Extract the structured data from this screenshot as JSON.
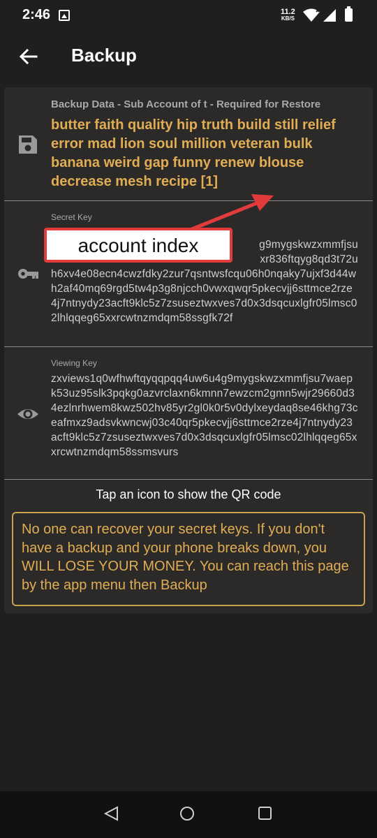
{
  "status_bar": {
    "time": "2:46",
    "net_speed_value": "11.2",
    "net_speed_unit": "KB/S"
  },
  "app_bar": {
    "title": "Backup",
    "back_icon": "arrow-back-icon"
  },
  "backup_data": {
    "label": "Backup Data - Sub Account of t - Required for Restore",
    "seed": "butter faith quality hip truth build still relief error mad lion soul million veteran bulk banana weird gap funny renew blouse decrease mesh recipe [1]",
    "icon": "save-icon"
  },
  "secret_key": {
    "label": "Secret Key",
    "value_visible_line1": "g9mygskwzxmmfjsu",
    "value_visible_line2": "xr836ftqyg8qd3t72u",
    "value_rest": "h6xv4e08ecn4cwzfdky2zur7qsntwsfcqu06h0nqaky7ujxf3d44wh2af40mq69rgd5tw4p3g8njcch0vwxqwqr5pkecvjj6sttmce2rze4j7ntnydy23acft9klc5z7zsuseztwxves7d0x3dsqcuxlgfr05lmsc02lhlqqeg65xxrcwtnzmdqm58ssgfk72f",
    "icon": "key-icon"
  },
  "viewing_key": {
    "label": "Viewing Key",
    "value": "zxviews1q0wfhwftqyqqpqq4uw6u4g9mygskwzxmmfjsu7waepk53uz95slk3pqkg0azvrclaxn6kmnn7ewzcm2gmn5wjr29660d34ezlnrhwem8kwz502hv85yr2gl0k0r5v0dylxeydaq8se46khg73ceafmxz9adsvkwncwj03c40qr5pkecvjj6sttmce2rze4j7ntnydy23acft9klc5z7zsuseztwxves7d0x3dsqcuxlgfr05lmsc02lhlqqeg65xxrcwtnzmdqm58ssmsvurs",
    "icon": "eye-icon"
  },
  "hint": "Tap an icon to show the QR code",
  "warning": "No one can recover your secret keys. If you don't have a backup and your phone breaks down, you WILL LOSE YOUR MONEY. You can reach this page by the app menu then Backup",
  "annotation": {
    "callout_text": "account index",
    "color": "#e23b3b"
  },
  "colors": {
    "accent": "#e0ad54",
    "background": "#1f1f1f",
    "card": "#2c2a28"
  }
}
